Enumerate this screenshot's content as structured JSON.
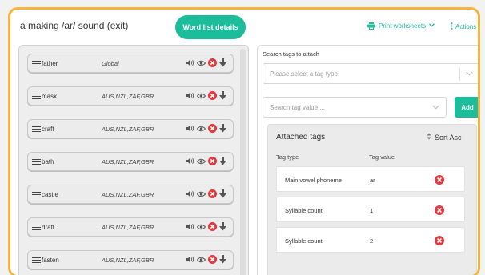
{
  "header": {
    "title": "a making /ar/ sound (exit)",
    "details_button": "Word list details",
    "print_label": "Print worksheets",
    "actions_label": "Actions"
  },
  "words": [
    {
      "word": "father",
      "regions": "Global"
    },
    {
      "word": "mask",
      "regions": "AUS,NZL,ZAF,GBR"
    },
    {
      "word": "craft",
      "regions": "AUS,NZL,ZAF,GBR"
    },
    {
      "word": "bath",
      "regions": "AUS,NZL,ZAF,GBR"
    },
    {
      "word": "castle",
      "regions": "AUS,NZL,ZAF,GBR"
    },
    {
      "word": "draft",
      "regions": "AUS,NZL,ZAF,GBR"
    },
    {
      "word": "fasten",
      "regions": "AUS,NZL,ZAF,GBR"
    }
  ],
  "tag_search": {
    "label": "Search tags to attach",
    "type_placeholder": "Please select a tag type.",
    "value_placeholder": "Search tag value ...",
    "add_label": "Add"
  },
  "attached": {
    "title": "Attached tags",
    "sort_label": "Sort Asc",
    "col_type": "Tag type",
    "col_value": "Tag value",
    "rows": [
      {
        "type": "Main vowel phoneme",
        "value": "ar"
      },
      {
        "type": "Syllable count",
        "value": "1"
      },
      {
        "type": "Syllable count",
        "value": "2"
      }
    ]
  },
  "colors": {
    "accent": "#1cbd9a",
    "frame": "#f5b43c",
    "delete": "#e0393e"
  }
}
